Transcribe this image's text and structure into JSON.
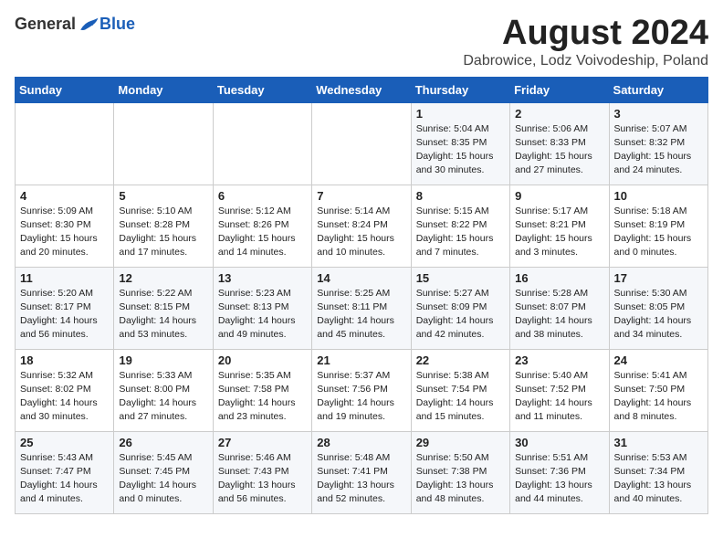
{
  "header": {
    "logo_general": "General",
    "logo_blue": "Blue",
    "month_year": "August 2024",
    "location": "Dabrowice, Lodz Voivodeship, Poland"
  },
  "weekdays": [
    "Sunday",
    "Monday",
    "Tuesday",
    "Wednesday",
    "Thursday",
    "Friday",
    "Saturday"
  ],
  "weeks": [
    [
      {
        "day": "",
        "info": ""
      },
      {
        "day": "",
        "info": ""
      },
      {
        "day": "",
        "info": ""
      },
      {
        "day": "",
        "info": ""
      },
      {
        "day": "1",
        "info": "Sunrise: 5:04 AM\nSunset: 8:35 PM\nDaylight: 15 hours\nand 30 minutes."
      },
      {
        "day": "2",
        "info": "Sunrise: 5:06 AM\nSunset: 8:33 PM\nDaylight: 15 hours\nand 27 minutes."
      },
      {
        "day": "3",
        "info": "Sunrise: 5:07 AM\nSunset: 8:32 PM\nDaylight: 15 hours\nand 24 minutes."
      }
    ],
    [
      {
        "day": "4",
        "info": "Sunrise: 5:09 AM\nSunset: 8:30 PM\nDaylight: 15 hours\nand 20 minutes."
      },
      {
        "day": "5",
        "info": "Sunrise: 5:10 AM\nSunset: 8:28 PM\nDaylight: 15 hours\nand 17 minutes."
      },
      {
        "day": "6",
        "info": "Sunrise: 5:12 AM\nSunset: 8:26 PM\nDaylight: 15 hours\nand 14 minutes."
      },
      {
        "day": "7",
        "info": "Sunrise: 5:14 AM\nSunset: 8:24 PM\nDaylight: 15 hours\nand 10 minutes."
      },
      {
        "day": "8",
        "info": "Sunrise: 5:15 AM\nSunset: 8:22 PM\nDaylight: 15 hours\nand 7 minutes."
      },
      {
        "day": "9",
        "info": "Sunrise: 5:17 AM\nSunset: 8:21 PM\nDaylight: 15 hours\nand 3 minutes."
      },
      {
        "day": "10",
        "info": "Sunrise: 5:18 AM\nSunset: 8:19 PM\nDaylight: 15 hours\nand 0 minutes."
      }
    ],
    [
      {
        "day": "11",
        "info": "Sunrise: 5:20 AM\nSunset: 8:17 PM\nDaylight: 14 hours\nand 56 minutes."
      },
      {
        "day": "12",
        "info": "Sunrise: 5:22 AM\nSunset: 8:15 PM\nDaylight: 14 hours\nand 53 minutes."
      },
      {
        "day": "13",
        "info": "Sunrise: 5:23 AM\nSunset: 8:13 PM\nDaylight: 14 hours\nand 49 minutes."
      },
      {
        "day": "14",
        "info": "Sunrise: 5:25 AM\nSunset: 8:11 PM\nDaylight: 14 hours\nand 45 minutes."
      },
      {
        "day": "15",
        "info": "Sunrise: 5:27 AM\nSunset: 8:09 PM\nDaylight: 14 hours\nand 42 minutes."
      },
      {
        "day": "16",
        "info": "Sunrise: 5:28 AM\nSunset: 8:07 PM\nDaylight: 14 hours\nand 38 minutes."
      },
      {
        "day": "17",
        "info": "Sunrise: 5:30 AM\nSunset: 8:05 PM\nDaylight: 14 hours\nand 34 minutes."
      }
    ],
    [
      {
        "day": "18",
        "info": "Sunrise: 5:32 AM\nSunset: 8:02 PM\nDaylight: 14 hours\nand 30 minutes."
      },
      {
        "day": "19",
        "info": "Sunrise: 5:33 AM\nSunset: 8:00 PM\nDaylight: 14 hours\nand 27 minutes."
      },
      {
        "day": "20",
        "info": "Sunrise: 5:35 AM\nSunset: 7:58 PM\nDaylight: 14 hours\nand 23 minutes."
      },
      {
        "day": "21",
        "info": "Sunrise: 5:37 AM\nSunset: 7:56 PM\nDaylight: 14 hours\nand 19 minutes."
      },
      {
        "day": "22",
        "info": "Sunrise: 5:38 AM\nSunset: 7:54 PM\nDaylight: 14 hours\nand 15 minutes."
      },
      {
        "day": "23",
        "info": "Sunrise: 5:40 AM\nSunset: 7:52 PM\nDaylight: 14 hours\nand 11 minutes."
      },
      {
        "day": "24",
        "info": "Sunrise: 5:41 AM\nSunset: 7:50 PM\nDaylight: 14 hours\nand 8 minutes."
      }
    ],
    [
      {
        "day": "25",
        "info": "Sunrise: 5:43 AM\nSunset: 7:47 PM\nDaylight: 14 hours\nand 4 minutes."
      },
      {
        "day": "26",
        "info": "Sunrise: 5:45 AM\nSunset: 7:45 PM\nDaylight: 14 hours\nand 0 minutes."
      },
      {
        "day": "27",
        "info": "Sunrise: 5:46 AM\nSunset: 7:43 PM\nDaylight: 13 hours\nand 56 minutes."
      },
      {
        "day": "28",
        "info": "Sunrise: 5:48 AM\nSunset: 7:41 PM\nDaylight: 13 hours\nand 52 minutes."
      },
      {
        "day": "29",
        "info": "Sunrise: 5:50 AM\nSunset: 7:38 PM\nDaylight: 13 hours\nand 48 minutes."
      },
      {
        "day": "30",
        "info": "Sunrise: 5:51 AM\nSunset: 7:36 PM\nDaylight: 13 hours\nand 44 minutes."
      },
      {
        "day": "31",
        "info": "Sunrise: 5:53 AM\nSunset: 7:34 PM\nDaylight: 13 hours\nand 40 minutes."
      }
    ]
  ]
}
